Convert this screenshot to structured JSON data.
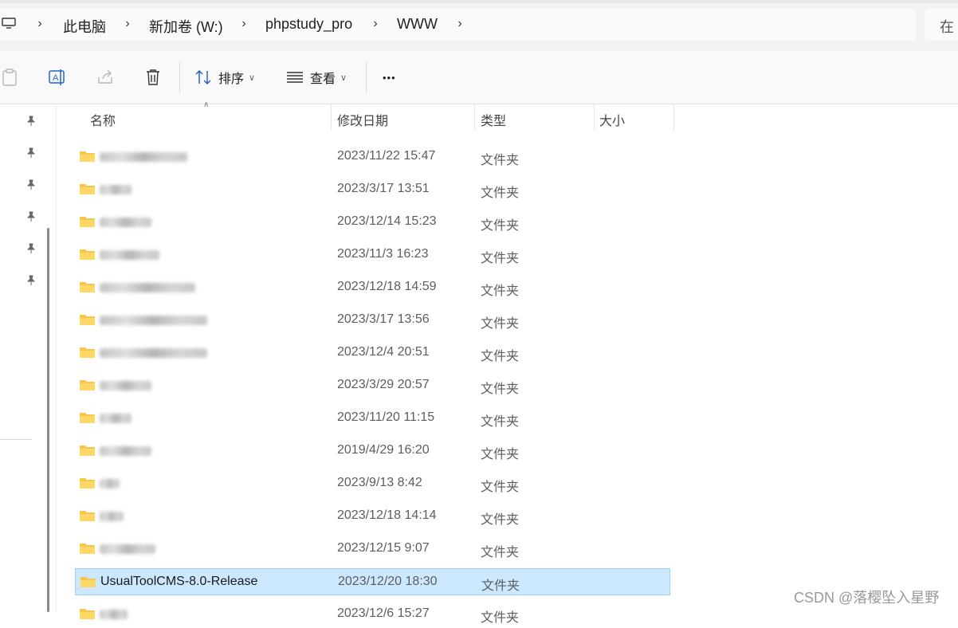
{
  "breadcrumb": {
    "items": [
      "此电脑",
      "新加卷 (W:)",
      "phpstudy_pro",
      "WWW"
    ],
    "root_icon": "computer-icon"
  },
  "search": {
    "placeholder": "在"
  },
  "toolbar": {
    "sort_label": "排序",
    "view_label": "查看",
    "more_label": "•••"
  },
  "columns": {
    "name": "名称",
    "date": "修改日期",
    "type": "类型",
    "size": "大小"
  },
  "files": [
    {
      "name": "",
      "date": "2023/11/22 15:47",
      "type": "文件夹"
    },
    {
      "name": "",
      "date": "2023/3/17 13:51",
      "type": "文件夹"
    },
    {
      "name": "",
      "date": "2023/12/14 15:23",
      "type": "文件夹"
    },
    {
      "name": "",
      "date": "2023/11/3 16:23",
      "type": "文件夹"
    },
    {
      "name": "",
      "date": "2023/12/18 14:59",
      "type": "文件夹"
    },
    {
      "name": "",
      "date": "2023/3/17 13:56",
      "type": "文件夹"
    },
    {
      "name": "",
      "date": "2023/12/4 20:51",
      "type": "文件夹"
    },
    {
      "name": "",
      "date": "2023/3/29 20:57",
      "type": "文件夹"
    },
    {
      "name": "",
      "date": "2023/11/20 11:15",
      "type": "文件夹"
    },
    {
      "name": "",
      "date": "2019/4/29 16:20",
      "type": "文件夹"
    },
    {
      "name": "",
      "date": "2023/9/13 8:42",
      "type": "文件夹"
    },
    {
      "name": "",
      "date": "2023/12/18 14:14",
      "type": "文件夹"
    },
    {
      "name": "",
      "date": "2023/12/15 9:07",
      "type": "文件夹"
    },
    {
      "name": "UsualToolCMS-8.0-Release",
      "date": "2023/12/20 18:30",
      "type": "文件夹",
      "selected": true
    },
    {
      "name": "",
      "date": "2023/12/6 15:27",
      "type": "文件夹"
    }
  ],
  "watermark": "CSDN @落樱坠入星野",
  "colors": {
    "selection_bg": "#cce8ff",
    "selection_border": "#99d1ff",
    "folder": "#f8c74a"
  }
}
